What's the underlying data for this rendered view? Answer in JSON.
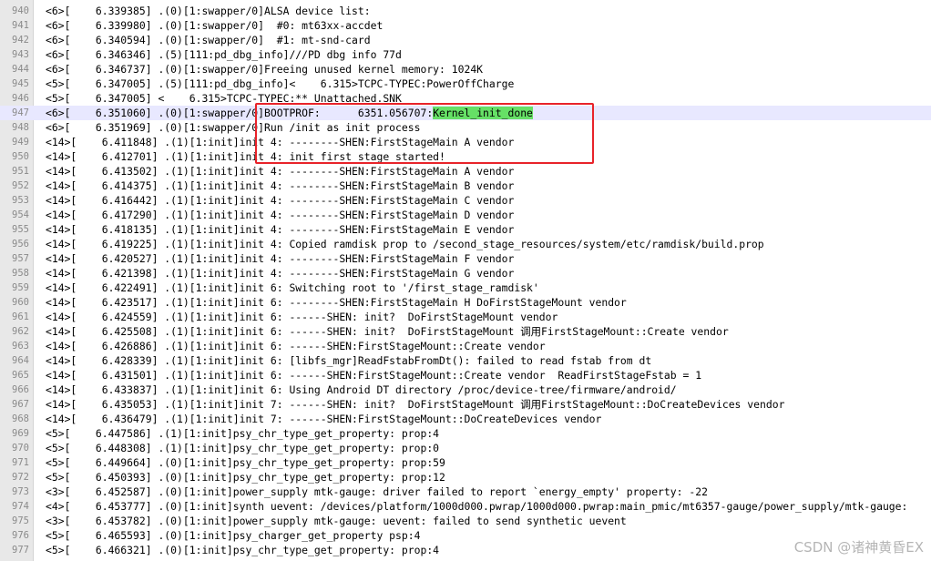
{
  "editor": {
    "current_line": "947",
    "lines": [
      {
        "num": "940",
        "text": "<6>[    6.339385] .(0)[1:swapper/0]ALSA device list:"
      },
      {
        "num": "941",
        "text": "<6>[    6.339980] .(0)[1:swapper/0]  #0: mt63xx-accdet"
      },
      {
        "num": "942",
        "text": "<6>[    6.340594] .(0)[1:swapper/0]  #1: mt-snd-card"
      },
      {
        "num": "943",
        "text": "<6>[    6.346346] .(5)[111:pd_dbg_info]///PD dbg info 77d"
      },
      {
        "num": "944",
        "text": "<6>[    6.346737] .(0)[1:swapper/0]Freeing unused kernel memory: 1024K"
      },
      {
        "num": "945",
        "text": "<5>[    6.347005] .(5)[111:pd_dbg_info]<    6.315>TCPC-TYPEC:PowerOffCharge"
      },
      {
        "num": "946",
        "text": "<5>[    6.347005] <    6.315>TCPC-TYPEC:** Unattached.SNK"
      },
      {
        "num": "947",
        "text": "<6>[    6.351060] .(0)[1:swapper/0]BOOTPROF:      6351.056707:",
        "highlight": "Kernel_init_done"
      },
      {
        "num": "948",
        "text": "<6>[    6.351969] .(0)[1:swapper/0]Run /init as init process"
      },
      {
        "num": "949",
        "text": "<14>[    6.411848] .(1)[1:init]init 4: --------SHEN:FirstStageMain A vendor"
      },
      {
        "num": "950",
        "text": "<14>[    6.412701] .(1)[1:init]init 4: init first stage started!"
      },
      {
        "num": "951",
        "text": "<14>[    6.413502] .(1)[1:init]init 4: --------SHEN:FirstStageMain A vendor"
      },
      {
        "num": "952",
        "text": "<14>[    6.414375] .(1)[1:init]init 4: --------SHEN:FirstStageMain B vendor"
      },
      {
        "num": "953",
        "text": "<14>[    6.416442] .(1)[1:init]init 4: --------SHEN:FirstStageMain C vendor"
      },
      {
        "num": "954",
        "text": "<14>[    6.417290] .(1)[1:init]init 4: --------SHEN:FirstStageMain D vendor"
      },
      {
        "num": "955",
        "text": "<14>[    6.418135] .(1)[1:init]init 4: --------SHEN:FirstStageMain E vendor"
      },
      {
        "num": "956",
        "text": "<14>[    6.419225] .(1)[1:init]init 4: Copied ramdisk prop to /second_stage_resources/system/etc/ramdisk/build.prop"
      },
      {
        "num": "957",
        "text": "<14>[    6.420527] .(1)[1:init]init 4: --------SHEN:FirstStageMain F vendor"
      },
      {
        "num": "958",
        "text": "<14>[    6.421398] .(1)[1:init]init 4: --------SHEN:FirstStageMain G vendor"
      },
      {
        "num": "959",
        "text": "<14>[    6.422491] .(1)[1:init]init 6: Switching root to '/first_stage_ramdisk'"
      },
      {
        "num": "960",
        "text": "<14>[    6.423517] .(1)[1:init]init 6: --------SHEN:FirstStageMain H DoFirstStageMount vendor"
      },
      {
        "num": "961",
        "text": "<14>[    6.424559] .(1)[1:init]init 6: ------SHEN: init?  DoFirstStageMount vendor"
      },
      {
        "num": "962",
        "text": "<14>[    6.425508] .(1)[1:init]init 6: ------SHEN: init?  DoFirstStageMount 调用FirstStageMount::Create vendor"
      },
      {
        "num": "963",
        "text": "<14>[    6.426886] .(1)[1:init]init 6: ------SHEN:FirstStageMount::Create vendor"
      },
      {
        "num": "964",
        "text": "<14>[    6.428339] .(1)[1:init]init 6: [libfs_mgr]ReadFstabFromDt(): failed to read fstab from dt"
      },
      {
        "num": "965",
        "text": "<14>[    6.431501] .(1)[1:init]init 6: ------SHEN:FirstStageMount::Create vendor  ReadFirstStageFstab = 1"
      },
      {
        "num": "966",
        "text": "<14>[    6.433837] .(1)[1:init]init 6: Using Android DT directory /proc/device-tree/firmware/android/"
      },
      {
        "num": "967",
        "text": "<14>[    6.435053] .(1)[1:init]init 7: ------SHEN: init?  DoFirstStageMount 调用FirstStageMount::DoCreateDevices vendor"
      },
      {
        "num": "968",
        "text": "<14>[    6.436479] .(1)[1:init]init 7: ------SHEN:FirstStageMount::DoCreateDevices vendor"
      },
      {
        "num": "969",
        "text": "<5>[    6.447586] .(1)[1:init]psy_chr_type_get_property: prop:4"
      },
      {
        "num": "970",
        "text": "<5>[    6.448308] .(1)[1:init]psy_chr_type_get_property: prop:0"
      },
      {
        "num": "971",
        "text": "<5>[    6.449664] .(0)[1:init]psy_chr_type_get_property: prop:59"
      },
      {
        "num": "972",
        "text": "<5>[    6.450393] .(0)[1:init]psy_chr_type_get_property: prop:12"
      },
      {
        "num": "973",
        "text": "<3>[    6.452587] .(0)[1:init]power_supply mtk-gauge: driver failed to report `energy_empty' property: -22"
      },
      {
        "num": "974",
        "text": "<4>[    6.453777] .(0)[1:init]synth uevent: /devices/platform/1000d000.pwrap/1000d000.pwrap:main_pmic/mt6357-gauge/power_supply/mtk-gauge:"
      },
      {
        "num": "975",
        "text": "<3>[    6.453782] .(0)[1:init]power_supply mtk-gauge: uevent: failed to send synthetic uevent"
      },
      {
        "num": "976",
        "text": "<5>[    6.465593] .(0)[1:init]psy_charger_get_property psp:4"
      },
      {
        "num": "977",
        "text": "<5>[    6.466321] .(0)[1:init]psy_chr_type_get_property: prop:4"
      }
    ]
  },
  "annotation": {
    "color": "#e8232a"
  },
  "watermark": "CSDN @诸神黄昏EX"
}
